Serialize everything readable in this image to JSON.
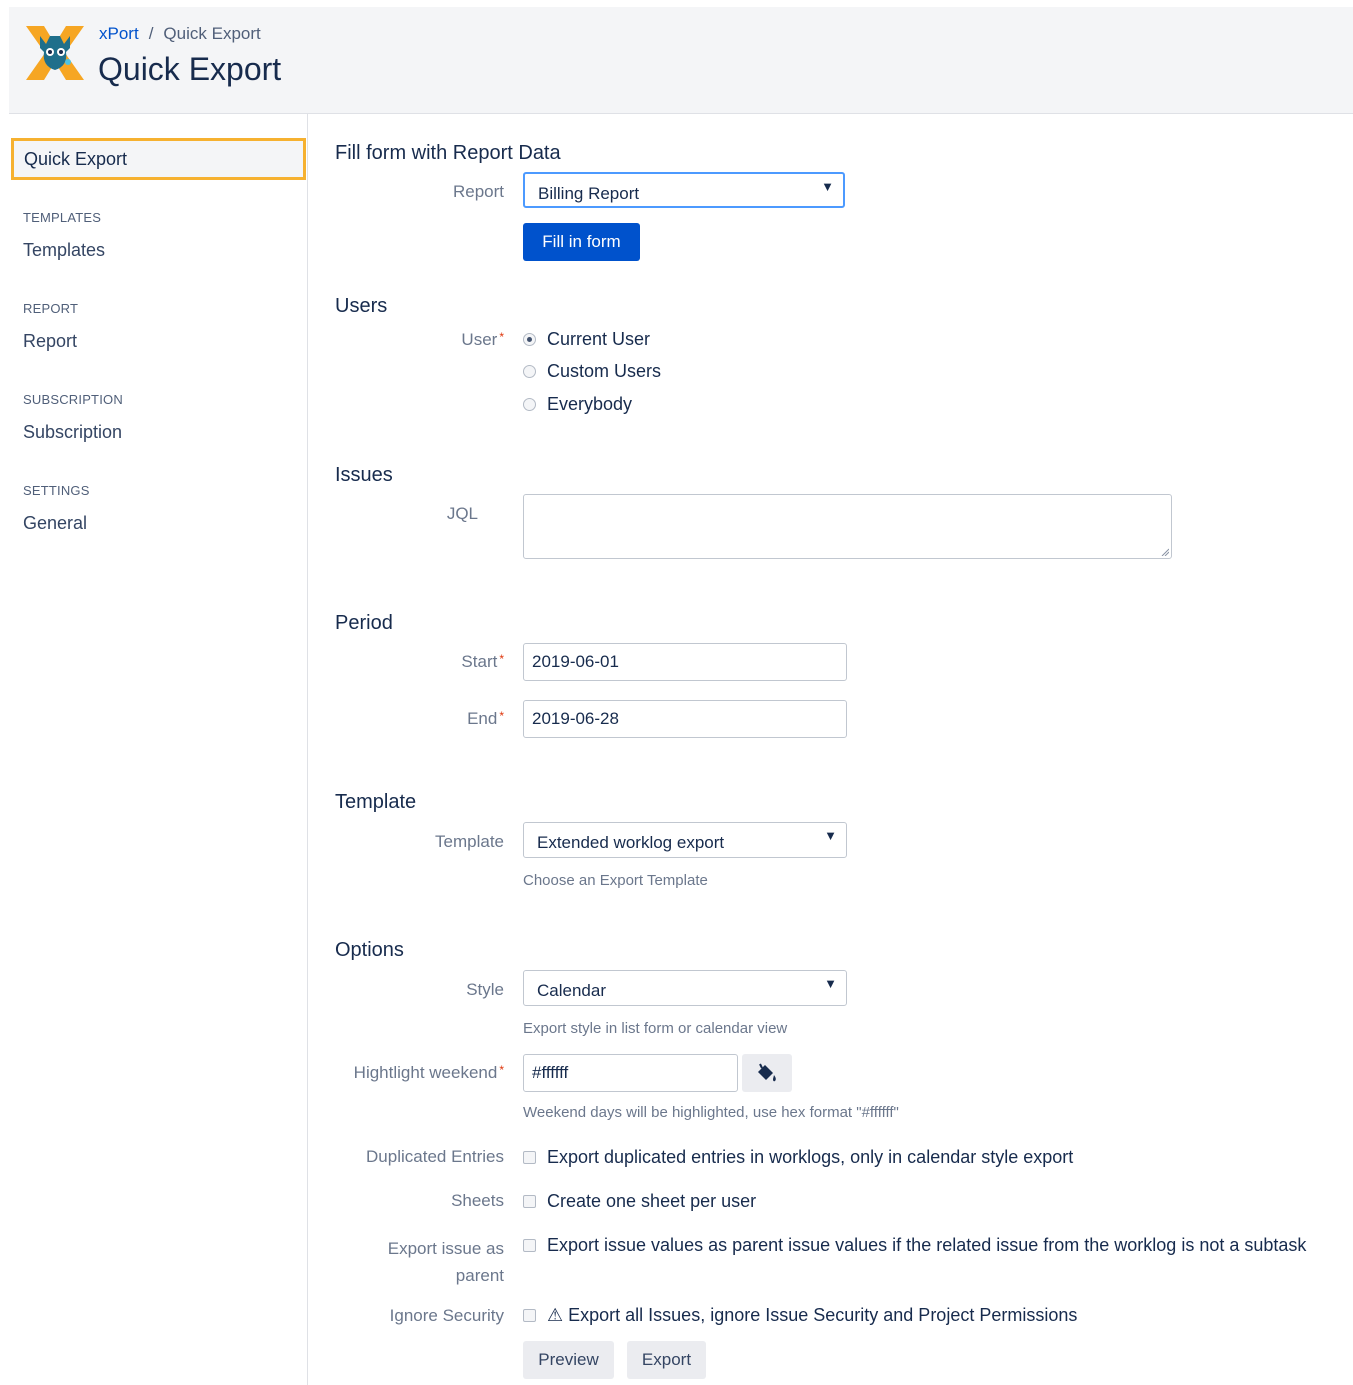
{
  "header": {
    "breadcrumb": {
      "app": "xPort",
      "separator": "/",
      "current": "Quick Export"
    },
    "title": "Quick Export",
    "logo_icon": "xport-logo-icon"
  },
  "sidebar": {
    "active_item": "Quick Export",
    "groups": [
      {
        "heading": "TEMPLATES",
        "item": "Templates"
      },
      {
        "heading": "REPORT",
        "item": "Report"
      },
      {
        "heading": "SUBSCRIPTION",
        "item": "Subscription"
      },
      {
        "heading": "SETTINGS",
        "item": "General"
      }
    ]
  },
  "report_section": {
    "title": "Fill form with Report Data",
    "report_label": "Report",
    "report_value": "Billing Report",
    "fill_button": "Fill in form"
  },
  "users_section": {
    "title": "Users",
    "user_label": "User",
    "required_mark": "*",
    "options": [
      "Current User",
      "Custom Users",
      "Everybody"
    ],
    "selected": "Current User"
  },
  "issues_section": {
    "title": "Issues",
    "jql_label": "JQL",
    "jql_value": ""
  },
  "period_section": {
    "title": "Period",
    "start_label": "Start",
    "start_value": "2019-06-01",
    "end_label": "End",
    "end_value": "2019-06-28"
  },
  "template_section": {
    "title": "Template",
    "template_label": "Template",
    "template_value": "Extended worklog export",
    "template_help": "Choose an Export Template"
  },
  "options_section": {
    "title": "Options",
    "style_label": "Style",
    "style_value": "Calendar",
    "style_help": "Export style in list form or calendar view",
    "weekend_label": "Hightlight weekend",
    "weekend_value": "#ffffff",
    "weekend_help": "Weekend days will be highlighted, use hex format \"#ffffff\"",
    "duplicated_label": "Duplicated Entries",
    "duplicated_text": "Export duplicated entries in worklogs, only in calendar style export",
    "sheets_label": "Sheets",
    "sheets_text": "Create one sheet per user",
    "parent_label_line1": "Export issue as",
    "parent_label_line2": "parent",
    "parent_text": "Export issue values as parent issue values if the related issue from the worklog is not a subtask",
    "security_label": "Ignore Security",
    "security_text": "⚠ Export all Issues, ignore Issue Security and Project Permissions"
  },
  "actions": {
    "preview": "Preview",
    "export": "Export"
  },
  "colors": {
    "primary": "#0052cc",
    "active_border": "#f6b130",
    "required": "#de350b"
  }
}
